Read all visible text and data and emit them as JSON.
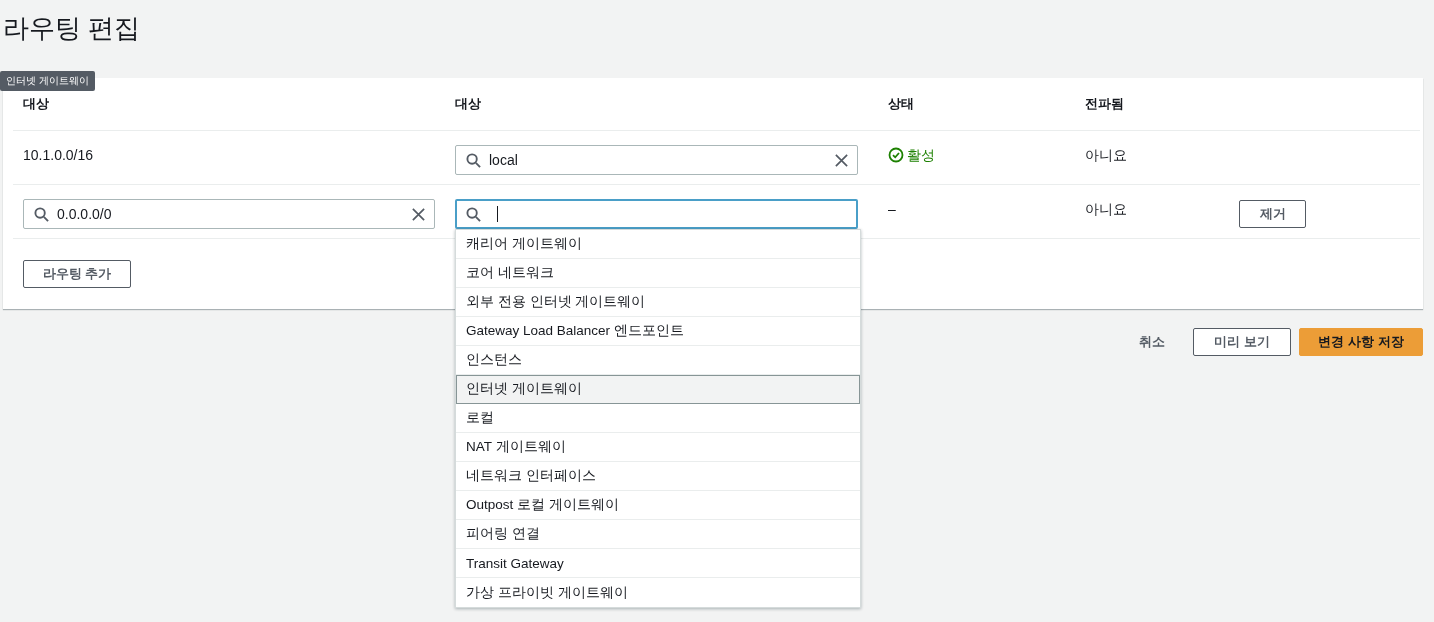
{
  "title": "라우팅 편집",
  "tooltip": "인터넷 게이트웨이",
  "table": {
    "columns": [
      "대상",
      "대상",
      "상태",
      "전파됨"
    ],
    "rows": [
      {
        "destination": {
          "kind": "text",
          "text": "10.1.0.0/16"
        },
        "target": {
          "value": "local",
          "focused": false
        },
        "status": {
          "kind": "success",
          "text": "활성"
        },
        "propagated": "아니요"
      },
      {
        "destination": {
          "kind": "field",
          "value": "0.0.0.0/0"
        },
        "target": {
          "focused": true
        },
        "status": {
          "kind": "plain",
          "text": "–"
        },
        "propagated": "아니요",
        "action": "제거"
      }
    ]
  },
  "dropdown": {
    "options": [
      {
        "label": "캐리어 게이트웨이",
        "selected": false
      },
      {
        "label": "코어 네트워크",
        "selected": false
      },
      {
        "label": "외부 전용 인터넷 게이트웨이",
        "selected": false
      },
      {
        "label": "Gateway Load Balancer 엔드포인트",
        "selected": false
      },
      {
        "label": "인스턴스",
        "selected": false
      },
      {
        "label": "인터넷 게이트웨이",
        "selected": true
      },
      {
        "label": "로컬",
        "selected": false
      },
      {
        "label": "NAT 게이트웨이",
        "selected": false
      },
      {
        "label": "네트워크 인터페이스",
        "selected": false
      },
      {
        "label": "Outpost 로컬 게이트웨이",
        "selected": false
      },
      {
        "label": "피어링 연결",
        "selected": false
      },
      {
        "label": "Transit Gateway",
        "selected": false
      },
      {
        "label": "가상 프라이빗 게이트웨이",
        "selected": false
      }
    ]
  },
  "add_button": "라우팅 추가",
  "footer": {
    "cancel": "취소",
    "preview": "미리 보기",
    "save": "변경 사항 저장"
  }
}
